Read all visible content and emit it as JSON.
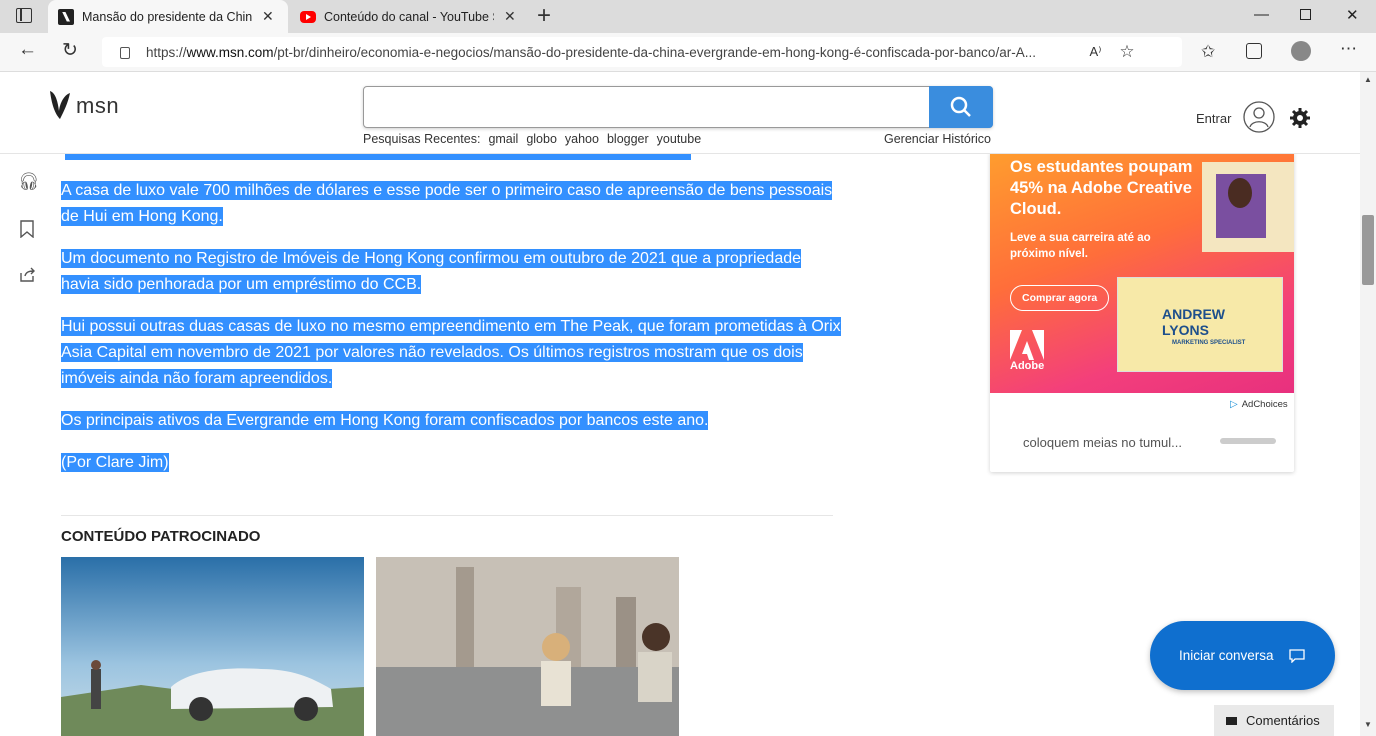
{
  "browser": {
    "tabs": [
      {
        "title": "Mansão do presidente da China",
        "active": true
      },
      {
        "title": "Conteúdo do canal - YouTube St",
        "active": false
      }
    ],
    "new_tab_label": "+",
    "url_prefix": "https://",
    "url_host": "www.msn.com",
    "url_path": "/pt-br/dinheiro/economia-e-negocios/mansão-do-presidente-da-china-evergrande-em-hong-kong-é-confiscada-por-banco/ar-A..."
  },
  "header": {
    "logo_text": "msn",
    "search_placeholder": "",
    "recent_label": "Pesquisas Recentes:",
    "recent_searches": [
      "gmail",
      "globo",
      "yahoo",
      "blogger",
      "youtube"
    ],
    "manage_history": "Gerenciar Histórico",
    "signin_label": "Entrar"
  },
  "article": {
    "paragraphs": [
      "A casa de luxo vale 700 milhões de dólares e esse pode ser o primeiro caso de apreensão de bens pessoais de Hui em Hong Kong.",
      "Um documento no Registro de Imóveis de Hong Kong confirmou em outubro de 2021 que a propriedade havia sido penhorada por um empréstimo do CCB.",
      "Hui possui outras duas casas de luxo no mesmo empreendimento em The Peak, que foram prometidas à Orix Asia Capital em novembro de 2021 por valores não revelados. Os últimos registros mostram que os dois imóveis ainda não foram apreendidos.",
      "Os principais ativos da Evergrande em Hong Kong foram confiscados por bancos este ano.",
      "(Por Clare Jim)"
    ],
    "sponsored_heading": "CONTEÚDO PATROCINADO"
  },
  "ad": {
    "headline": "Os estudantes poupam 45% na Adobe Creative Cloud.",
    "subline": "Leve a sua carreira até ao próximo nível.",
    "cta": "Comprar agora",
    "brand": "Adobe",
    "badge_name": "ANDREW LYONS",
    "badge_role": "MARKETING SPECIALIST",
    "adchoices": "AdChoices",
    "below_text": "coloquem meias no tumul..."
  },
  "chat": {
    "label": "Iniciar conversa"
  },
  "comments": {
    "label": "Comentários"
  },
  "colors": {
    "highlight": "#3390ff",
    "accent": "#0f6fcf",
    "search_button": "#3a8dde"
  }
}
